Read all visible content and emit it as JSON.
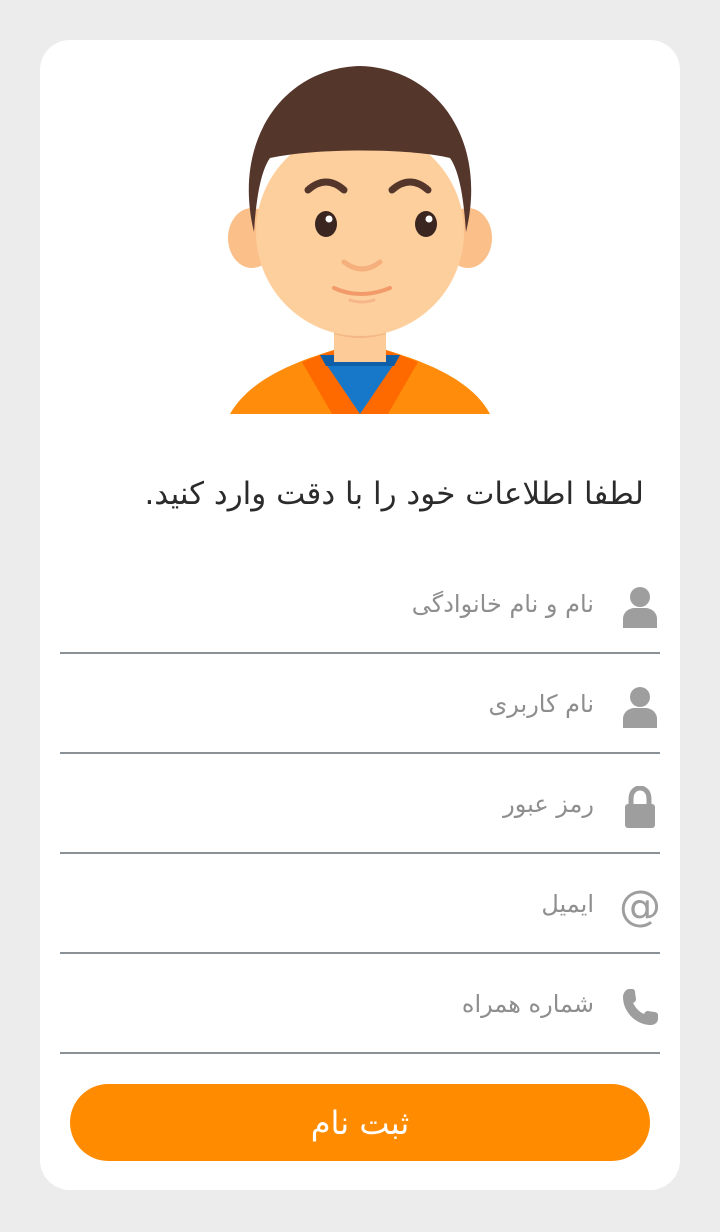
{
  "form": {
    "instruction": "لطفا اطلاعات خود را با دقت وارد کنید.",
    "fields": [
      {
        "placeholder": "نام و نام خانوادگی",
        "value": "",
        "icon": "user-icon"
      },
      {
        "placeholder": "نام کاربری",
        "value": "",
        "icon": "user-icon"
      },
      {
        "placeholder": "رمز عبور",
        "value": "",
        "icon": "lock-icon"
      },
      {
        "placeholder": "ایمیل",
        "value": "",
        "icon": "at-sign-icon"
      },
      {
        "placeholder": "شماره همراه",
        "value": "",
        "icon": "phone-icon"
      }
    ],
    "submit_label": "ثبت نام"
  },
  "colors": {
    "background": "#ececec",
    "card": "#ffffff",
    "accent": "#ff8c00",
    "icon": "#9e9e9e",
    "divider": "#8a9298"
  }
}
